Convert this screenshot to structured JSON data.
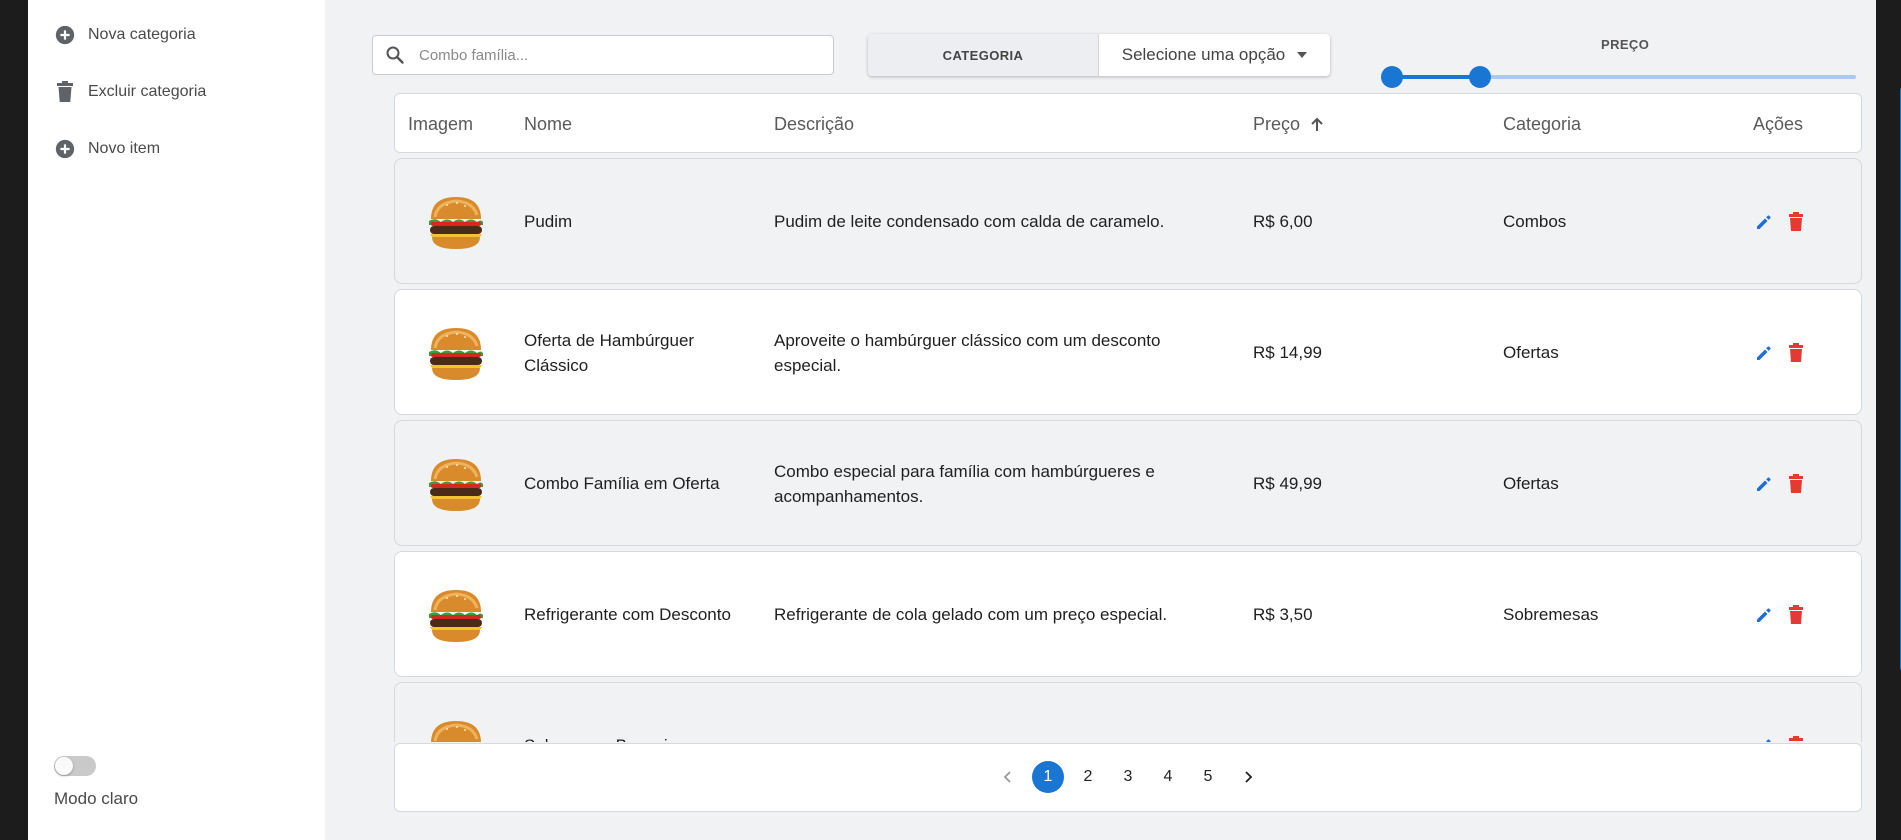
{
  "sidebar": {
    "items": [
      {
        "label": "Nova categoria",
        "icon": "add-circle-icon"
      },
      {
        "label": "Excluir categoria",
        "icon": "trash-icon"
      },
      {
        "label": "Novo item",
        "icon": "add-circle-icon"
      }
    ],
    "theme_toggle": {
      "label": "Modo claro",
      "checked": false
    }
  },
  "toolbar": {
    "search_placeholder": "Combo família...",
    "category_button": "CATEGORIA",
    "category_select": "Selecione uma opção",
    "price_label": "PREÇO",
    "price_range": {
      "min_fraction": 0.0,
      "max_fraction": 0.19
    }
  },
  "table": {
    "columns": {
      "image": "Imagem",
      "name": "Nome",
      "description": "Descrição",
      "price": "Preço",
      "category": "Categoria",
      "actions": "Ações"
    },
    "sort": {
      "column": "price",
      "direction": "ascending"
    },
    "rows": [
      {
        "name": "Pudim",
        "description": "Pudim de leite condensado com calda de caramelo.",
        "price": "R$ 6,00",
        "category": "Combos"
      },
      {
        "name": "Oferta de Hambúrguer Clássico",
        "description": "Aproveite o hambúrguer clássico com um desconto especial.",
        "price": "R$ 14,99",
        "category": "Ofertas"
      },
      {
        "name": "Combo Família em Oferta",
        "description": "Combo especial para família com hambúrgueres e acompanhamentos.",
        "price": "R$ 49,99",
        "category": "Ofertas"
      },
      {
        "name": "Refrigerante com Desconto",
        "description": "Refrigerante de cola gelado com um preço especial.",
        "price": "R$ 3,50",
        "category": "Sobremesas"
      },
      {
        "name": "Sobremesa Brownie",
        "description": "",
        "price": "",
        "category": ""
      }
    ]
  },
  "pagination": {
    "pages": [
      "1",
      "2",
      "3",
      "4",
      "5"
    ],
    "current": "1",
    "prev_icon": "chevron-left-icon",
    "next_icon": "chevron-right-icon"
  },
  "colors": {
    "accent": "#1976d2",
    "delete": "#e53935",
    "edit": "#1e6fd9"
  }
}
